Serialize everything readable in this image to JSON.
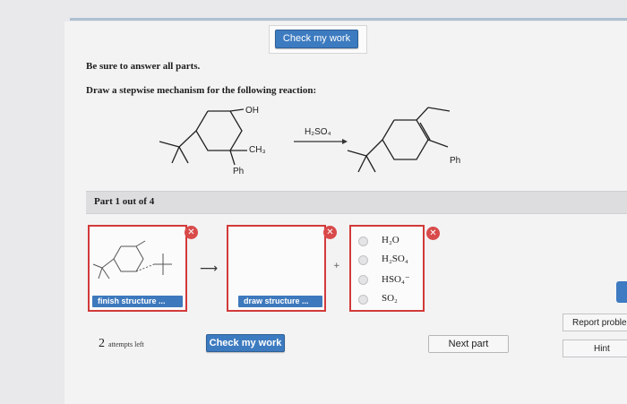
{
  "header": {
    "check_button_label": "Check my work"
  },
  "instructions": {
    "answer_all": "Be sure to answer all parts.",
    "prompt": "Draw a stepwise mechanism for the following reaction:"
  },
  "reaction": {
    "reagent": "H₂SO₄",
    "reactant_labels": {
      "hydroxyl": "OH",
      "methyl": "CH₃",
      "phenyl": "Ph"
    },
    "product_labels": {
      "phenyl": "Ph"
    }
  },
  "part": {
    "label": "Part 1 out of 4"
  },
  "workspace": {
    "panel1_button": "finish structure ...",
    "panel2_button": "draw structure ...",
    "plus": "+",
    "options": [
      "H₂O",
      "H₂SO₄",
      "HSO₄⁻",
      "SO₂"
    ]
  },
  "footer": {
    "attempts_count": "2",
    "attempts_text": "attempts left",
    "check_label": "Check my work",
    "next_label": "Next part",
    "report_label": "Report problem",
    "hint_label": "Hint"
  },
  "icons": {
    "close": "close-icon",
    "arrow": "right-arrow-icon",
    "radio": "radio-button"
  },
  "colors": {
    "accent": "#3d7bc0",
    "error": "#d23a3a",
    "background": "#f3f3f4"
  }
}
